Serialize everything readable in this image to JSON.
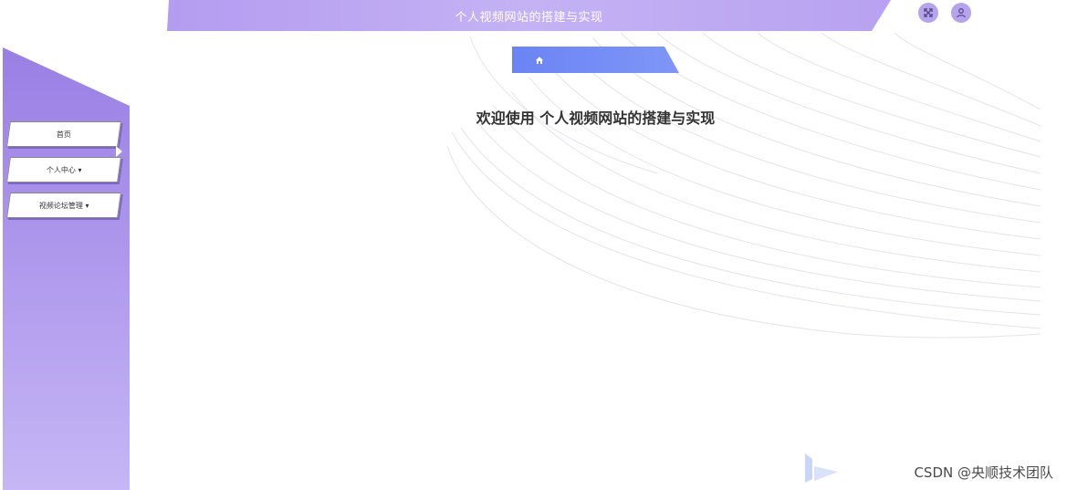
{
  "header": {
    "title": "个人视频网站的搭建与实现",
    "icons": [
      "fullscreen-icon",
      "user-icon"
    ]
  },
  "sidebar": {
    "items": [
      {
        "label": "首页"
      },
      {
        "label": "个人中心 ▾"
      },
      {
        "label": "视频论坛管理 ▾"
      }
    ]
  },
  "breadcrumb": {
    "icon": "home-icon"
  },
  "main": {
    "welcome": "欢迎使用 个人视频网站的搭建与实现"
  },
  "watermark": "CSDN @央顺技术团队",
  "colors": {
    "header": "#b49cf0",
    "sidebar": "#9a7fe4",
    "breadcrumb": "#6a84f4"
  }
}
